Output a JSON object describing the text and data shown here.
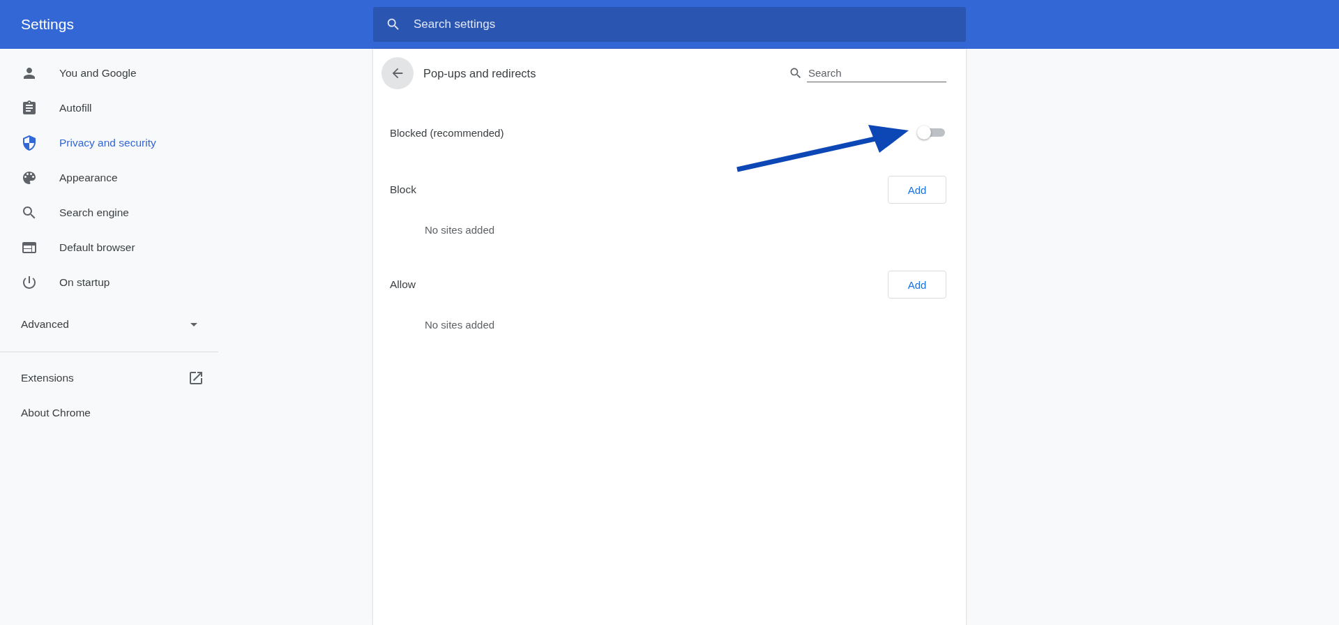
{
  "header": {
    "title": "Settings",
    "search": {
      "placeholder": "Search settings"
    }
  },
  "sidebar": {
    "items": [
      {
        "label": "You and Google",
        "selected": false
      },
      {
        "label": "Autofill",
        "selected": false
      },
      {
        "label": "Privacy and security",
        "selected": true
      },
      {
        "label": "Appearance",
        "selected": false
      },
      {
        "label": "Search engine",
        "selected": false
      },
      {
        "label": "Default browser",
        "selected": false
      },
      {
        "label": "On startup",
        "selected": false
      }
    ],
    "advanced": {
      "label": "Advanced",
      "expanded": false
    },
    "links": [
      {
        "label": "Extensions",
        "external": true
      },
      {
        "label": "About Chrome",
        "external": false
      }
    ]
  },
  "page": {
    "title": "Pop-ups and redirects",
    "search": {
      "placeholder": "Search"
    },
    "toggle": {
      "label": "Blocked (recommended)",
      "on": false
    },
    "sections": [
      {
        "title": "Block",
        "button": "Add",
        "empty": "No sites added"
      },
      {
        "title": "Allow",
        "button": "Add",
        "empty": "No sites added"
      }
    ]
  }
}
